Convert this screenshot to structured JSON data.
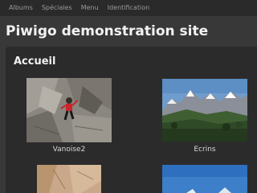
{
  "nav": {
    "items": [
      "Albums",
      "Spéciales",
      "Menu",
      "Identification"
    ]
  },
  "site": {
    "title": "Piwigo demonstration site"
  },
  "section": {
    "title": "Accueil"
  },
  "albums": [
    {
      "name": "Vanoise2"
    },
    {
      "name": "Ecrins"
    },
    {
      "name": ""
    },
    {
      "name": ""
    }
  ],
  "colors": {
    "background": "#383838",
    "nav_background": "#2a2a2a",
    "panel_background": "#2b2b2b",
    "title_text": "#f2f2f2",
    "nav_text": "#9a9a9a"
  }
}
